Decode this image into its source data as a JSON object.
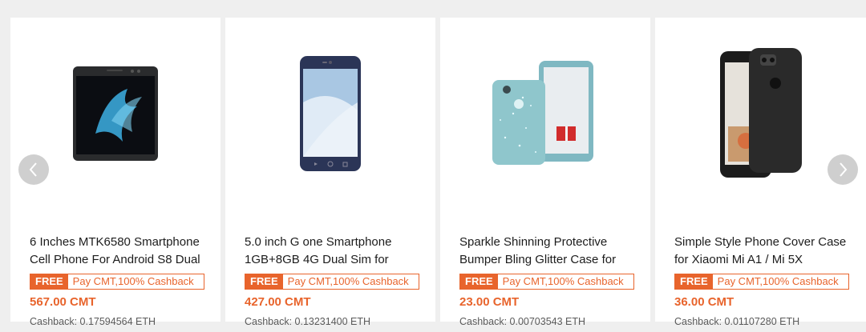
{
  "products": [
    {
      "title": "6 Inches MTK6580 Smartphone Cell Phone For Android S8 Dual",
      "free_label": "FREE",
      "promo_text": "Pay CMT,100% Cashback",
      "price": "567.00 CMT",
      "cashback": "Cashback: 0.17594564 ETH",
      "image_icon": "smartphone-black-image"
    },
    {
      "title": "5.0 inch G one Smartphone 1GB+8GB 4G Dual Sim for",
      "free_label": "FREE",
      "promo_text": "Pay CMT,100% Cashback",
      "price": "427.00 CMT",
      "cashback": "Cashback: 0.13231400 ETH",
      "image_icon": "smartphone-blue-image"
    },
    {
      "title": "Sparkle Shinning Protective Bumper Bling Glitter Case for",
      "free_label": "FREE",
      "promo_text": "Pay CMT,100% Cashback",
      "price": "23.00 CMT",
      "cashback": "Cashback: 0.00703543 ETH",
      "image_icon": "glitter-case-image"
    },
    {
      "title": "Simple Style Phone Cover Case for Xiaomi Mi A1 / Mi 5X",
      "free_label": "FREE",
      "promo_text": "Pay CMT,100% Cashback",
      "price": "36.00 CMT",
      "cashback": "Cashback: 0.01107280 ETH",
      "image_icon": "phone-cover-case-image"
    }
  ],
  "nav": {
    "prev_icon": "chevron-left-icon",
    "next_icon": "chevron-right-icon"
  },
  "colors": {
    "accent": "#e8642c",
    "background": "#efefef",
    "card": "#ffffff"
  }
}
